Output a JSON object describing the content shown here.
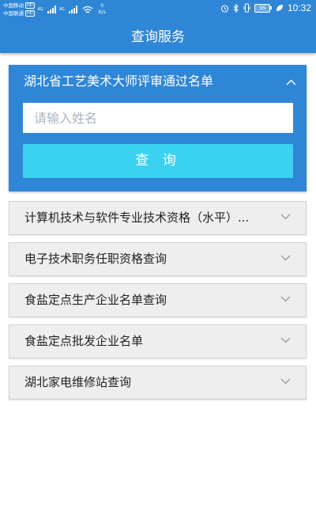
{
  "status_bar": {
    "carrier1": "中国移动",
    "carrier1_badge": "HD",
    "carrier2": "中国联通",
    "carrier2_badge": "HD",
    "net1": "4G",
    "net2": "4G",
    "speed_value": "0",
    "speed_unit": "K/s",
    "battery": "95",
    "time": "10:32"
  },
  "header": {
    "title": "查询服务"
  },
  "active_panel": {
    "title": "湖北省工艺美术大师评审通过名单",
    "input_placeholder": "请输入姓名",
    "input_value": "",
    "button_label": "查 询"
  },
  "panels": [
    {
      "label": "计算机技术与软件专业技术资格（水平）..."
    },
    {
      "label": "电子技术职务任职资格查询"
    },
    {
      "label": "食盐定点生产企业名单查询"
    },
    {
      "label": "食盐定点批发企业名单"
    },
    {
      "label": "湖北家电维修站查询"
    }
  ],
  "colors": {
    "primary": "#2f86d6",
    "button": "#3ad2f0",
    "panel_bg": "#eeeeee"
  }
}
